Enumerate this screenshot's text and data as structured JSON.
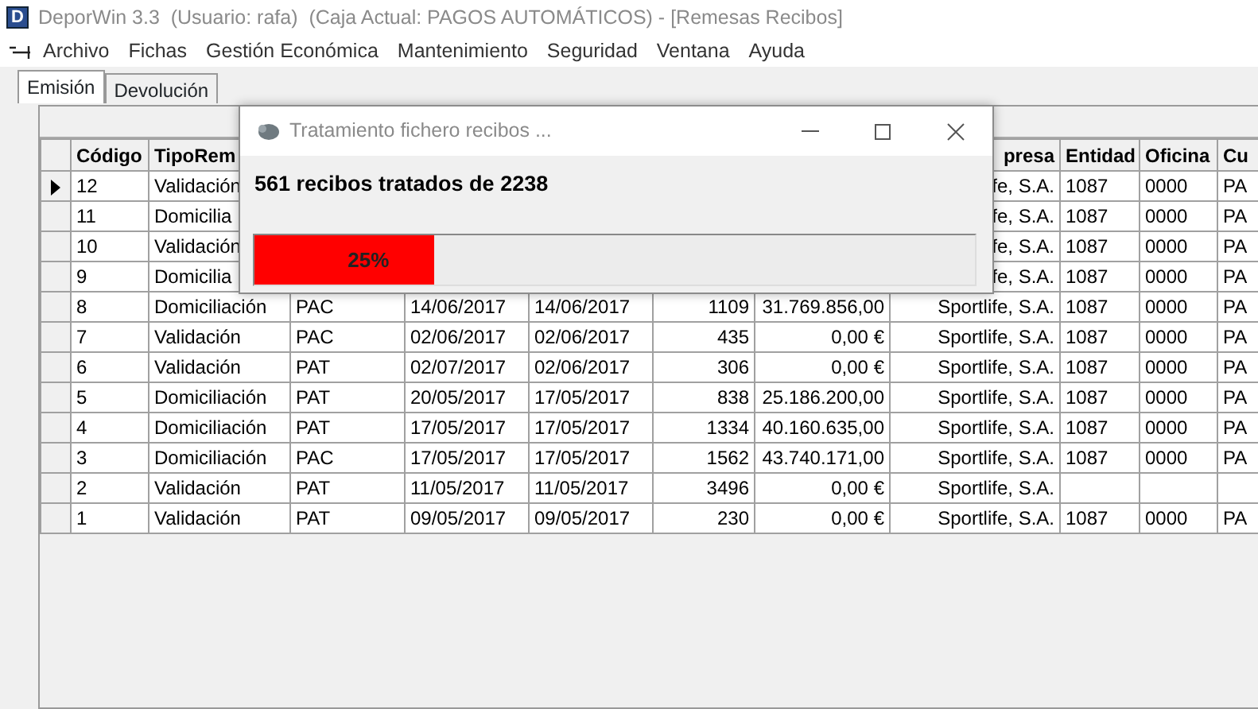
{
  "window": {
    "icon_letter": "D",
    "title": "DeporWin 3.3  (Usuario: rafa)  (Caja Actual: PAGOS AUTOMÁTICOS) - [Remesas Recibos]"
  },
  "menu": [
    "Archivo",
    "Fichas",
    "Gestión Económica",
    "Mantenimiento",
    "Seguridad",
    "Ventana",
    "Ayuda"
  ],
  "tabs": [
    {
      "label": "Emisión",
      "selected": true
    },
    {
      "label": "Devolución",
      "selected": false
    }
  ],
  "table": {
    "columns_left": [
      "Código",
      "TipoRem"
    ],
    "columns_right": [
      "presa",
      "Entidad",
      "Oficina",
      "Cu"
    ],
    "rows": [
      {
        "current": true,
        "cells": [
          "12",
          "Validación"
        ],
        "tail": [
          "fe, S.A.",
          "1087",
          "0000",
          "PA"
        ]
      },
      {
        "current": false,
        "cells": [
          "11",
          "Domicilia"
        ],
        "tail": [
          "fe, S.A.",
          "1087",
          "0000",
          "PA"
        ]
      },
      {
        "current": false,
        "cells": [
          "10",
          "Validación"
        ],
        "tail": [
          "fe, S.A.",
          "1087",
          "0000",
          "PA"
        ]
      },
      {
        "current": false,
        "cells": [
          "9",
          "Domicilia"
        ],
        "tail": [
          "fe, S.A.",
          "1087",
          "0000",
          "PA"
        ]
      },
      {
        "current": false,
        "cells": [
          "8",
          "Domiciliación",
          "PAC",
          "14/06/2017",
          "14/06/2017",
          "1109",
          "31.769.856,00",
          "Sportlife, S.A.",
          "1087",
          "0000",
          "PA"
        ]
      },
      {
        "current": false,
        "cells": [
          "7",
          "Validación",
          "PAC",
          "02/06/2017",
          "02/06/2017",
          "435",
          "0,00 €",
          "Sportlife, S.A.",
          "1087",
          "0000",
          "PA"
        ]
      },
      {
        "current": false,
        "cells": [
          "6",
          "Validación",
          "PAT",
          "02/07/2017",
          "02/06/2017",
          "306",
          "0,00 €",
          "Sportlife, S.A.",
          "1087",
          "0000",
          "PA"
        ]
      },
      {
        "current": false,
        "cells": [
          "5",
          "Domiciliación",
          "PAT",
          "20/05/2017",
          "17/05/2017",
          "838",
          "25.186.200,00",
          "Sportlife, S.A.",
          "1087",
          "0000",
          "PA"
        ]
      },
      {
        "current": false,
        "cells": [
          "4",
          "Domiciliación",
          "PAT",
          "17/05/2017",
          "17/05/2017",
          "1334",
          "40.160.635,00",
          "Sportlife, S.A.",
          "1087",
          "0000",
          "PA"
        ]
      },
      {
        "current": false,
        "cells": [
          "3",
          "Domiciliación",
          "PAC",
          "17/05/2017",
          "17/05/2017",
          "1562",
          "43.740.171,00",
          "Sportlife, S.A.",
          "1087",
          "0000",
          "PA"
        ]
      },
      {
        "current": false,
        "cells": [
          "2",
          "Validación",
          "PAT",
          "11/05/2017",
          "11/05/2017",
          "3496",
          "0,00 €",
          "Sportlife, S.A."
        ]
      },
      {
        "current": false,
        "cells": [
          "1",
          "Validación",
          "PAT",
          "09/05/2017",
          "09/05/2017",
          "230",
          "0,00 €",
          "Sportlife, S.A.",
          "1087",
          "0000",
          "PA"
        ]
      }
    ]
  },
  "dialog": {
    "title": "Tratamiento fichero recibos ...",
    "message": "561 recibos tratados de 2238",
    "progress": {
      "level": 0.25,
      "label": "25%"
    }
  }
}
